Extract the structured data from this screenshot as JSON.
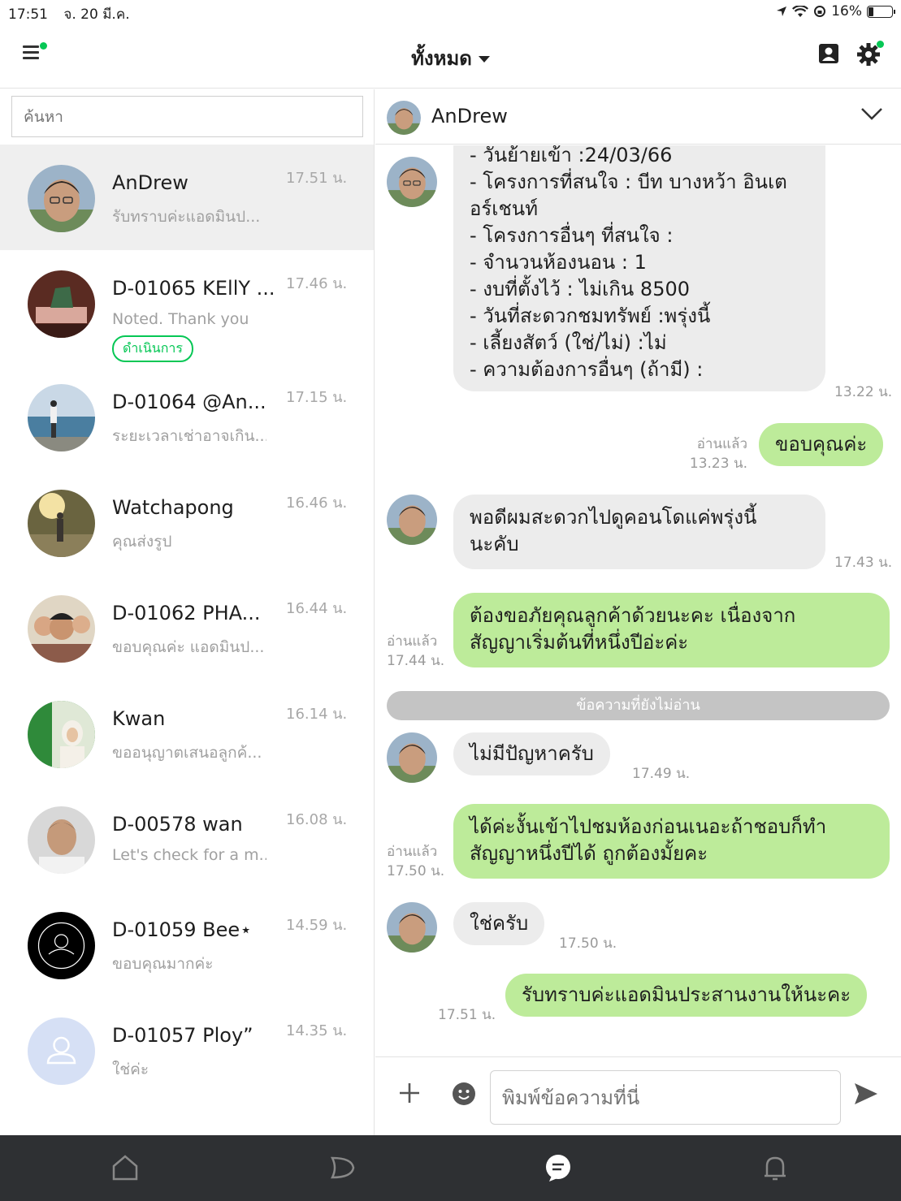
{
  "status_bar": {
    "time": "17:51",
    "date": "จ. 20 มี.ค.",
    "battery": "16%"
  },
  "header": {
    "filter_label": "ทั้งหมด"
  },
  "search": {
    "placeholder": "ค้นหา"
  },
  "chats": [
    {
      "name": "AnDrew",
      "preview": "รับทราบค่ะแอดมินป...",
      "time": "17.51 น.",
      "active": true
    },
    {
      "name": "D-01065 KEllY ...",
      "preview": "Noted. Thank you",
      "time": "17.46 น.",
      "badge": "ดำเนินการ"
    },
    {
      "name": "D-01064 @An...",
      "preview": "ระยะเวลาเช่าอาจเกิน...",
      "time": "17.15 น."
    },
    {
      "name": "Watchapong",
      "preview": "คุณส่งรูป",
      "time": "16.46 น."
    },
    {
      "name": "D-01062 PHA...",
      "preview": "ขอบคุณค่ะ แอดมินป...",
      "time": "16.44 น."
    },
    {
      "name": "Kwan",
      "preview": "ขออนุญาตเสนอลูกค้...",
      "time": "16.14 น."
    },
    {
      "name": "D-00578 wan",
      "preview": "Let's check for a m...",
      "time": "16.08 น."
    },
    {
      "name": "D-01059 Bee⋆",
      "preview": "ขอบคุณมากค่ะ",
      "time": "14.59 น."
    },
    {
      "name": "D-01057 Ploy”",
      "preview": "ใช่ค่ะ",
      "time": "14.35 น."
    }
  ],
  "conversation": {
    "title": "AnDrew",
    "messages": [
      {
        "dir": "in",
        "lines": [
          "- วันย้ายเข้า :24/03/66",
          "- โครงการที่สนใจ : บีท บางหว้า อินเต",
          "อร์เชนท์",
          "- โครงการอื่นๆ ที่สนใจ :",
          "- จำนวนห้องนอน : 1",
          "- งบที่ตั้งไว้ : ไม่เกิน 8500",
          "- วันที่สะดวกชมทรัพย์ :พรุ่งนี้",
          "- เลี้ยงสัตว์ (ใช่/ไม่) :ไม่",
          "- ความต้องการอื่นๆ (ถ้ามี) :"
        ],
        "time": "13.22 น."
      },
      {
        "dir": "out",
        "lines": [
          "ขอบคุณค่ะ"
        ],
        "read": "อ่านแล้ว",
        "time": "13.23 น."
      },
      {
        "dir": "in",
        "lines": [
          "พอดีผมสะดวกไปดูคอนโดแค่พรุ่งนี้",
          "นะคับ"
        ],
        "time": "17.43 น."
      },
      {
        "dir": "out",
        "lines": [
          "ต้องขอภัยคุณลูกค้าด้วยนะคะ เนื่องจาก",
          "สัญญาเริ่มต้นที่หนึ่งปีอ่ะค่ะ"
        ],
        "read": "อ่านแล้ว",
        "time": "17.44 น."
      },
      {
        "dir": "in",
        "lines": [
          "ไม่มีปัญหาครับ"
        ],
        "time": "17.49 น."
      },
      {
        "dir": "out",
        "lines": [
          "ได้ค่ะงั้นเข้าไปชมห้องก่อนเนอะถ้าชอบก็ทำ",
          "สัญญาหนึ่งปีได้ ถูกต้องมั้ยคะ"
        ],
        "read": "อ่านแล้ว",
        "time": "17.50 น."
      },
      {
        "dir": "in",
        "lines": [
          "ใช่ครับ"
        ],
        "time": "17.50 น."
      },
      {
        "dir": "out",
        "lines": [
          "รับทราบค่ะแอดมินประสานงานให้นะคะ"
        ],
        "time": "17.51 น."
      }
    ],
    "unread_divider": "ข้อความที่ยังไม่อ่าน",
    "input_placeholder": "พิมพ์ข้อความที่นี่"
  },
  "colors": {
    "accent": "#06c755",
    "outgoing_bubble": "#bdeb9a",
    "incoming_bubble": "#ececec",
    "bottom_nav": "#2e3033"
  },
  "icons": [
    "menu-icon",
    "contacts-icon",
    "gear-icon",
    "chevron-down-icon",
    "plus-icon",
    "emoji-icon",
    "send-icon",
    "home-icon",
    "timeline-icon",
    "chat-icon",
    "bell-icon"
  ]
}
